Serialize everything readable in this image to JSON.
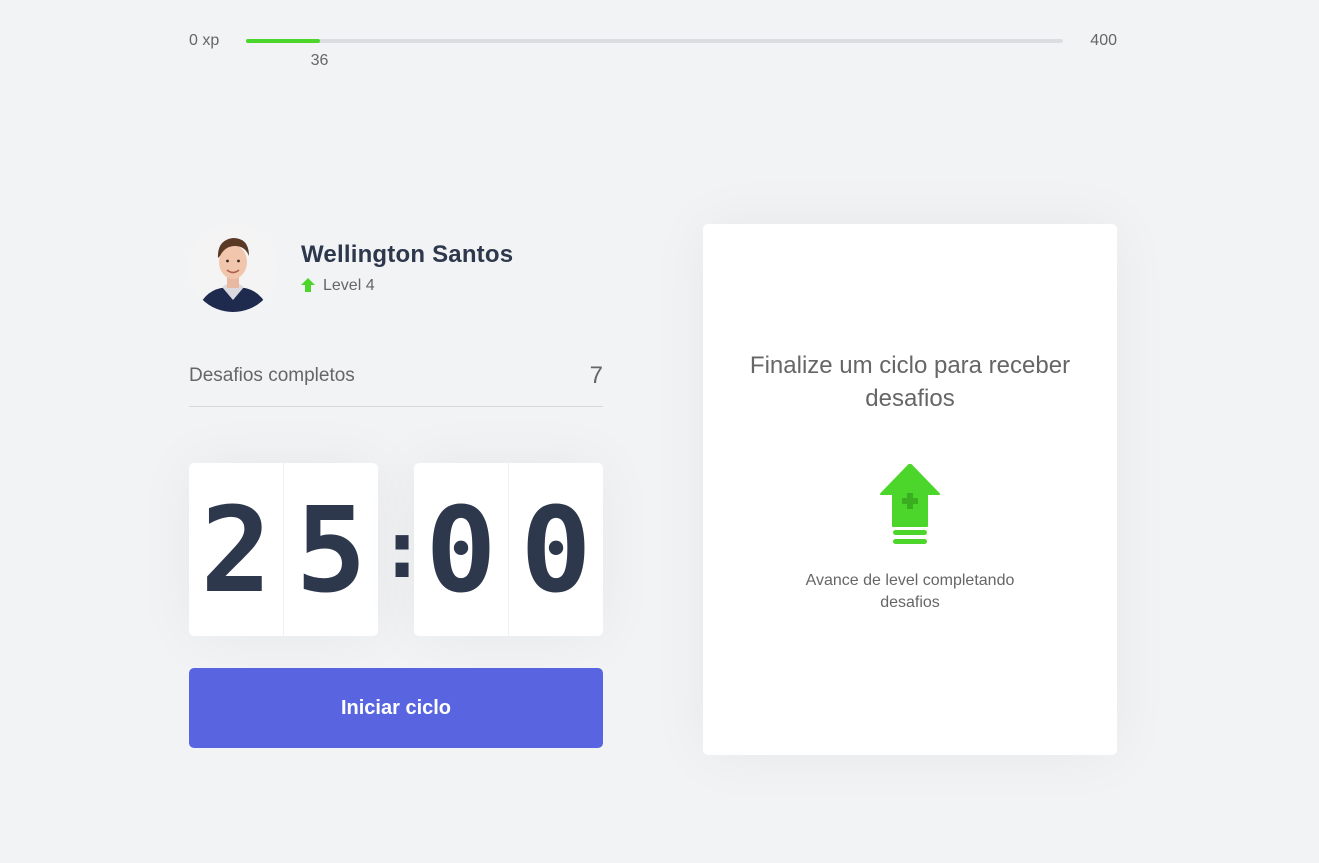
{
  "xp": {
    "min_label": "0 xp",
    "max_label": "400",
    "current_label": "36",
    "current": 36,
    "max": 400,
    "accent_color": "#4cd62b"
  },
  "profile": {
    "name": "Wellington Santos",
    "level_label": "Level 4",
    "level_icon": "level-up-arrow-icon",
    "avatar": "avatar-photo"
  },
  "challenges": {
    "completed_label": "Desafios completos",
    "completed_count": "7"
  },
  "countdown": {
    "minute_left": "2",
    "minute_right": "5",
    "separator": ":",
    "second_left": "0",
    "second_right": "0"
  },
  "start_button": {
    "label": "Iniciar ciclo",
    "color": "#5965e0"
  },
  "challenge_box": {
    "title": "Finalize um ciclo para receber desafios",
    "icon": "level-up-icon",
    "hint": "Avance de level completando desafios"
  }
}
